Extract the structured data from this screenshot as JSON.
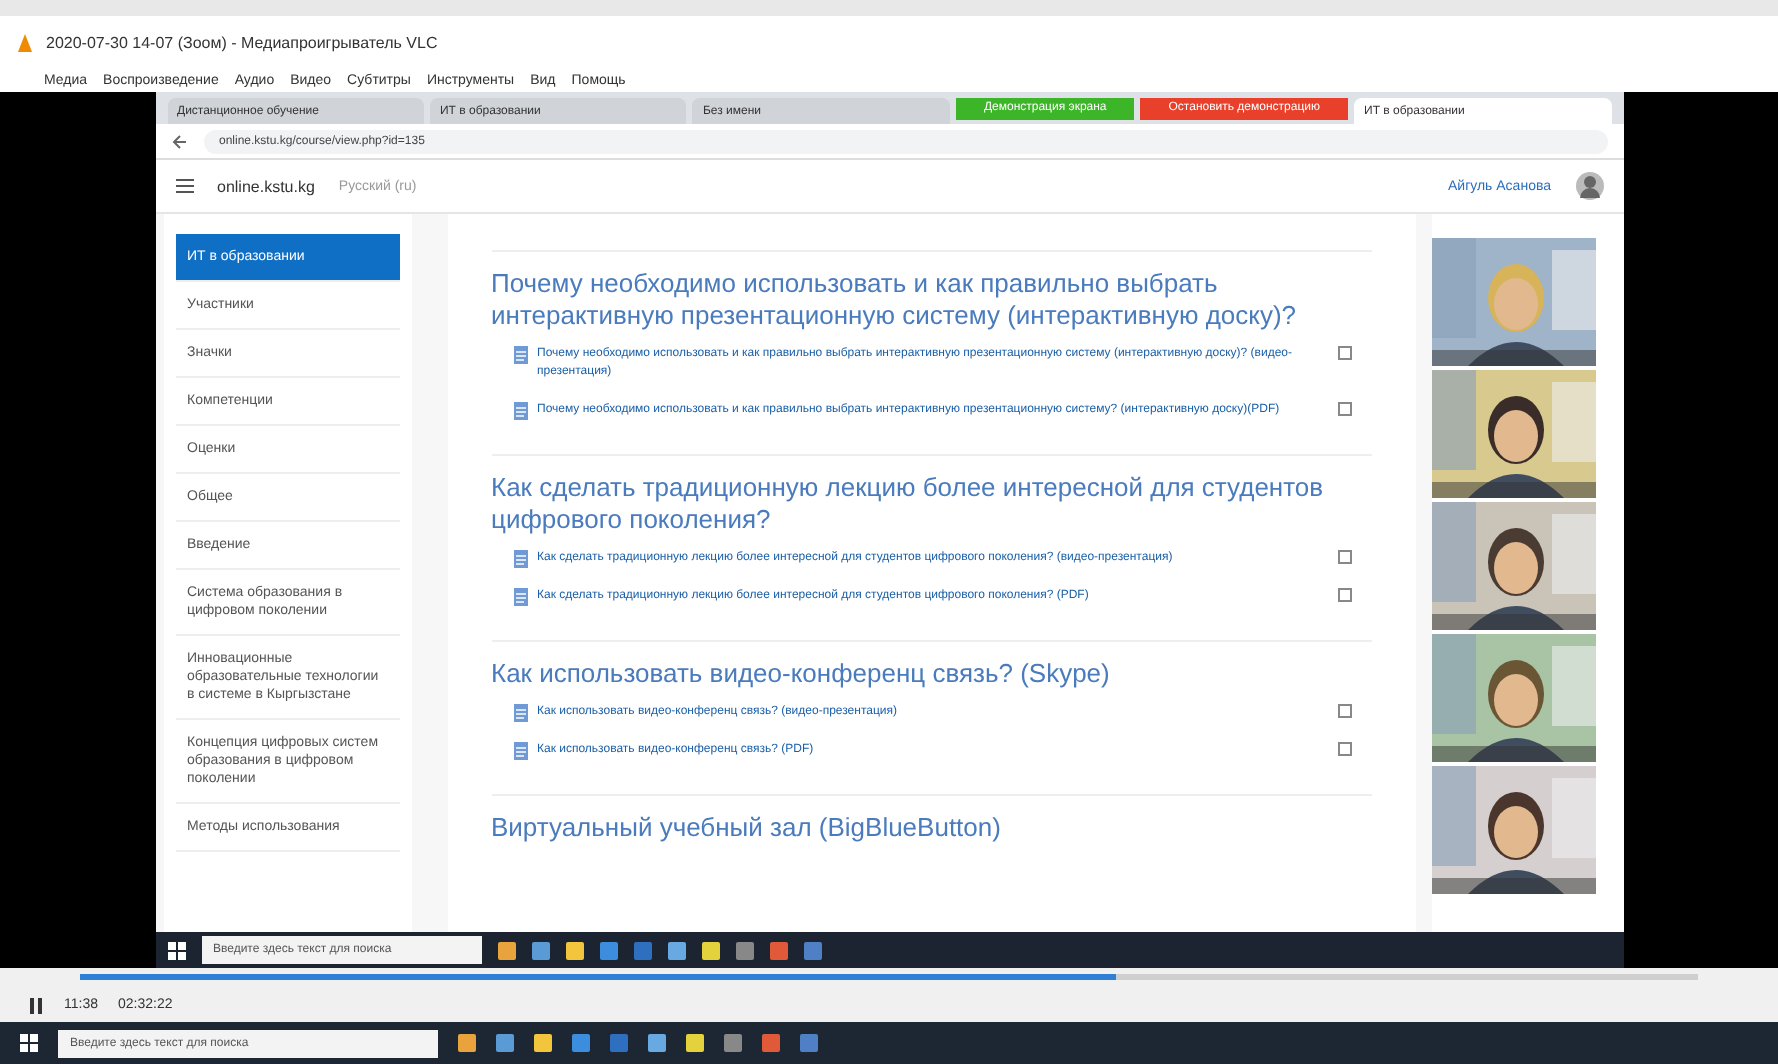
{
  "player": {
    "title": "2020-07-30 14-07 (Зоом) - Медиапроигрыватель VLC",
    "menu": [
      "Медиа",
      "Воспроизведение",
      "Аудио",
      "Видео",
      "Субтитры",
      "Инструменты",
      "Вид",
      "Помощь"
    ],
    "elapsed": "11:38",
    "total": "02:32:22",
    "level": 0.64
  },
  "browser": {
    "tabs": [
      {
        "label": "Дистанционное обучение",
        "selected": false
      },
      {
        "label": "ИТ в образовании",
        "selected": false
      },
      {
        "label": "Без имени",
        "selected": false
      },
      {
        "label": "ИТ в образовании",
        "selected": true
      }
    ],
    "banners": [
      {
        "label": "Демонстрация экрана",
        "color": "#3cb528"
      },
      {
        "label": "Остановить демонстрацию",
        "color": "#e8402a"
      }
    ],
    "address": "online.kstu.kg/course/view.php?id=135"
  },
  "site": {
    "brand": "online.kstu.kg",
    "language": "Русский ‎(ru)‎",
    "user": "Айгуль Асанова"
  },
  "sidebar": [
    {
      "label": "ИТ в образовании",
      "selected": true
    },
    {
      "label": "Участники",
      "selected": false
    },
    {
      "label": "Значки",
      "selected": false
    },
    {
      "label": "Компетенции",
      "selected": false
    },
    {
      "label": "Оценки",
      "selected": false
    },
    {
      "label": "Общее",
      "selected": false
    },
    {
      "label": "Введение",
      "selected": false
    },
    {
      "label": "Система образования в цифровом поколении",
      "selected": false
    },
    {
      "label": "Инновационные образовательные технологии в системе в Кыргызстане",
      "selected": false
    },
    {
      "label": "Концепция цифровых систем образования в цифровом поколении",
      "selected": false
    },
    {
      "label": "Методы использования",
      "selected": false
    }
  ],
  "sections": [
    {
      "title": "Почему необходимо использовать и как правильно выбрать интерактивную презентационную систему (интерактивную доску)?",
      "links": [
        "Почему необходимо использовать и как правильно выбрать интерактивную презентационную систему (интерактивную доску)? (видео-презентация)",
        "Почему необходимо использовать и как правильно выбрать интерактивную презентационную систему? (интерактивную доску)(PDF)"
      ]
    },
    {
      "title": "Как сделать традиционную лекцию более интересной для студентов цифрового поколения?",
      "links": [
        "Как сделать традиционную лекцию более интересной для студентов цифрового поколения? (видео-презентация)",
        "Как сделать традиционную лекцию более интересной для студентов цифрового поколения? (PDF)"
      ]
    },
    {
      "title": "Как использовать видео-конференц связь? (Skype)",
      "links": [
        "Как использовать видео-конференц связь? (видео-презентация)",
        "Как использовать видео-конференц связь? (PDF)"
      ]
    },
    {
      "title": "Виртуальный учебный зал (BigBlueButton)"
    }
  ],
  "inner_taskbar": {
    "search": "Введите здесь текст для поиска"
  },
  "taskbar": {
    "search": "Введите здесь текст для поиска"
  }
}
